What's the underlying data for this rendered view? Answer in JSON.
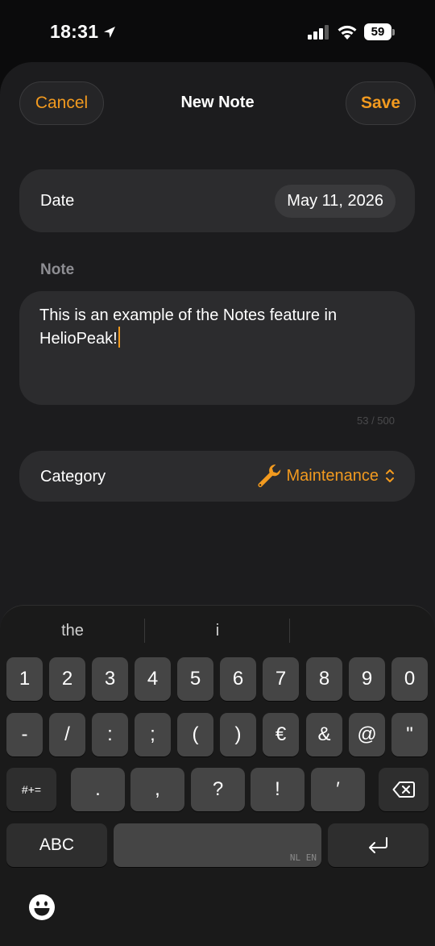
{
  "status": {
    "time": "18:31",
    "battery": "59"
  },
  "nav": {
    "cancel": "Cancel",
    "title": "New Note",
    "save": "Save"
  },
  "date_row": {
    "label": "Date",
    "value": "May 11, 2026"
  },
  "note": {
    "header": "Note",
    "text": "This is an example of the Notes feature in HelioPeak!",
    "char_count": "53 / 500"
  },
  "category_row": {
    "label": "Category",
    "value": "Maintenance",
    "icon": "wrench-icon"
  },
  "colors": {
    "accent": "#f29a1f",
    "background": "#1c1c1e",
    "card": "#2c2c2e"
  },
  "keyboard": {
    "suggestions": [
      "the",
      "i",
      ""
    ],
    "row1": [
      "1",
      "2",
      "3",
      "4",
      "5",
      "6",
      "7",
      "8",
      "9",
      "0"
    ],
    "row2": [
      "-",
      "/",
      ":",
      ";",
      "(",
      ")",
      "€",
      "&",
      "@",
      "\""
    ],
    "row3": [
      "#+=",
      ".",
      ",",
      "?",
      "!",
      "′"
    ],
    "abc": "ABC",
    "space_hint": "NL EN"
  }
}
